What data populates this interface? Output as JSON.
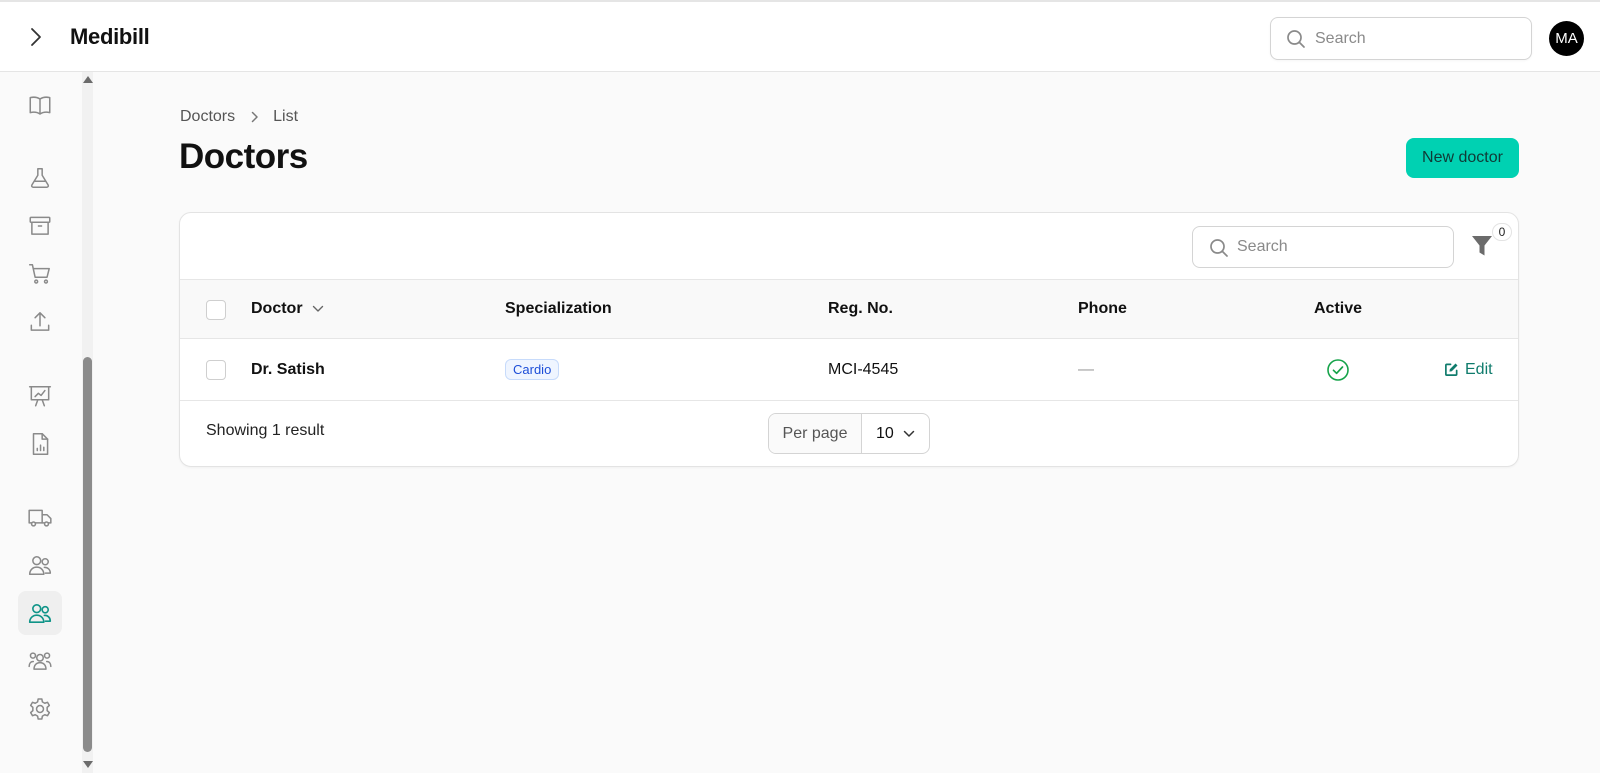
{
  "app": {
    "title": "Medibill"
  },
  "header": {
    "search_placeholder": "Search",
    "avatar_initials": "MA"
  },
  "sidebar": {
    "items": [
      {
        "icon": "book-icon",
        "active": false
      },
      {
        "icon": "flask-icon",
        "active": false
      },
      {
        "icon": "archive-icon",
        "active": false
      },
      {
        "icon": "cart-icon",
        "active": false
      },
      {
        "icon": "upload-icon",
        "active": false
      },
      {
        "icon": "presentation-chart-icon",
        "active": false
      },
      {
        "icon": "document-chart-icon",
        "active": false
      },
      {
        "icon": "truck-icon",
        "active": false
      },
      {
        "icon": "users-icon",
        "active": false
      },
      {
        "icon": "users-icon",
        "active": true
      },
      {
        "icon": "user-group-icon",
        "active": false
      },
      {
        "icon": "gear-icon",
        "active": false
      }
    ],
    "active_color": "#0f9488"
  },
  "breadcrumb": {
    "parent": "Doctors",
    "current": "List"
  },
  "page": {
    "title": "Doctors",
    "new_button": "New doctor"
  },
  "table": {
    "search_placeholder": "Search",
    "filter_count": "0",
    "columns": [
      "Doctor",
      "Specialization",
      "Reg. No.",
      "Phone",
      "Active"
    ],
    "rows": [
      {
        "doctor": "Dr. Satish",
        "specialization": "Cardio",
        "reg_no": "MCI-4545",
        "phone": "—",
        "active": true,
        "action": "Edit"
      }
    ],
    "footer": {
      "showing": "Showing 1 result",
      "per_page_label": "Per page",
      "per_page_value": "10"
    }
  },
  "colors": {
    "primary_button": "#00d1b2",
    "link": "#0f7b6c",
    "active_check": "#16a34a",
    "badge_text": "#1d4ed8"
  }
}
